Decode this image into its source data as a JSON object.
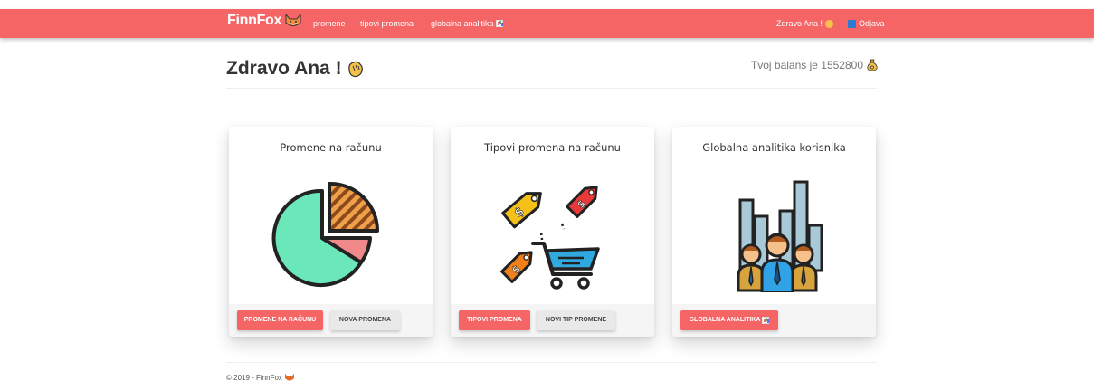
{
  "navbar": {
    "brand": "FinnFox",
    "links": [
      "promene",
      "tipovi promena",
      "globalna analitika"
    ],
    "greeting": "Zdravo Ana !",
    "logout": "Odjava"
  },
  "header": {
    "greeting": "Zdravo Ana !",
    "balance_text": "Tvoj balans je 1552800"
  },
  "cards": [
    {
      "title": "Promene na računu",
      "icon": "pie-chart-icon",
      "buttons": [
        "PROMENE NA RAČUNU",
        "NOVA PROMENA"
      ]
    },
    {
      "title": "Tipovi promena na računu",
      "icon": "shopping-cart-tags-icon",
      "buttons": [
        "TIPOVI PROMENA",
        "NOVI TIP PROMENE"
      ]
    },
    {
      "title": "Globalna analitika korisnika",
      "icon": "users-analytics-icon",
      "buttons": [
        "GLOBALNA ANALITIKA"
      ]
    }
  ],
  "footer": {
    "text": "© 2019 - FinnFox"
  },
  "colors": {
    "accent": "#f56565",
    "card_footer": "#f5f5f5"
  }
}
